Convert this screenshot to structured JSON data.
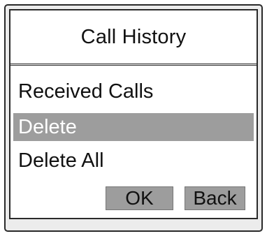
{
  "screen": {
    "title": "Call History"
  },
  "menu": {
    "items": [
      {
        "label": "Received Calls",
        "selected": false
      },
      {
        "label": "Delete",
        "selected": true
      },
      {
        "label": "Delete All",
        "selected": false
      }
    ]
  },
  "softkeys": {
    "ok_label": "OK",
    "back_label": "Back"
  },
  "colors": {
    "selection": "#9d9d9d",
    "softkey": "#9d9d9d",
    "border": "#2a2a2a",
    "frame": "#ececec"
  }
}
